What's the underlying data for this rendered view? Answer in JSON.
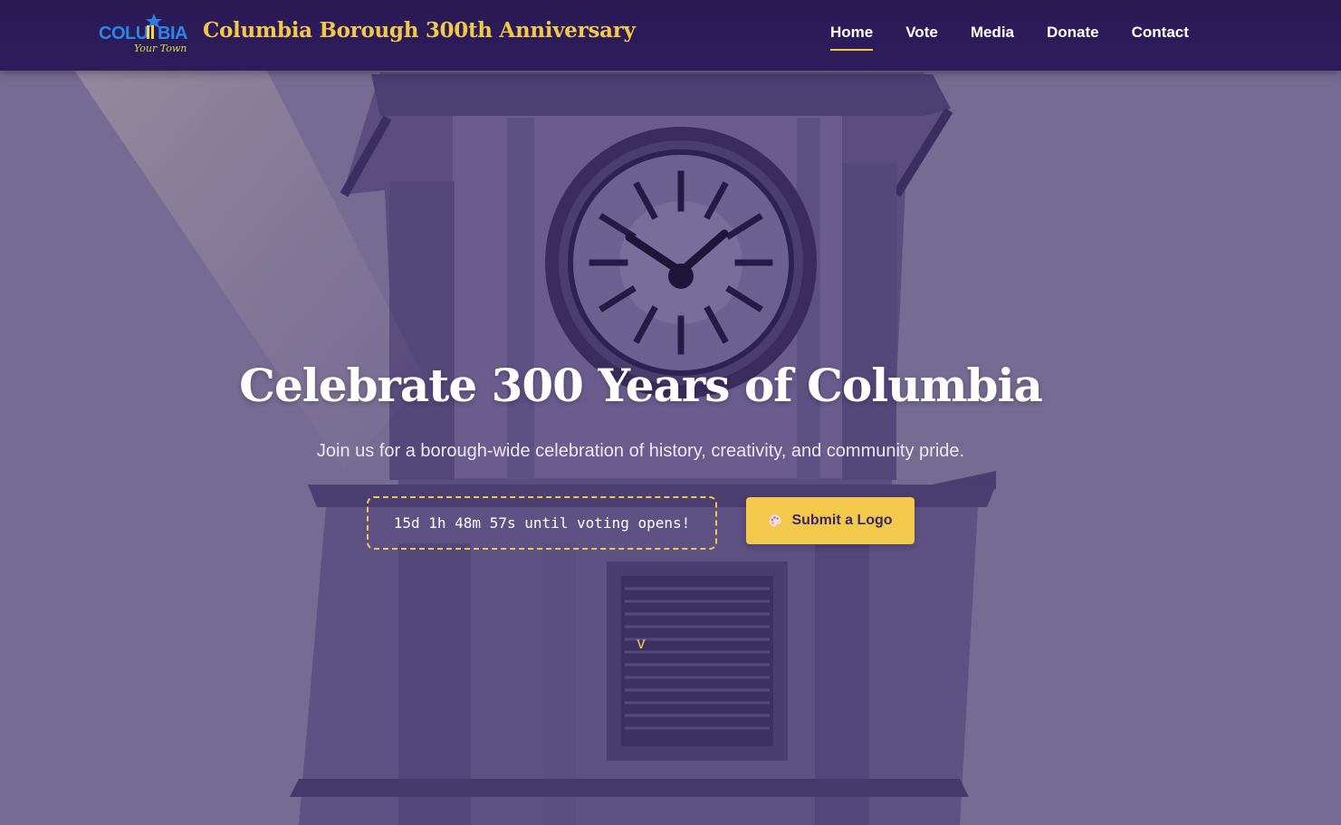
{
  "header": {
    "logo": {
      "name": "columbia-your-town-logo",
      "text_top": "COLUMBIA",
      "text_bottom": "Your Town"
    },
    "title": "Columbia Borough 300th Anniversary",
    "nav": [
      {
        "label": "Home",
        "active": true
      },
      {
        "label": "Vote",
        "active": false
      },
      {
        "label": "Media",
        "active": false
      },
      {
        "label": "Donate",
        "active": false
      },
      {
        "label": "Contact",
        "active": false
      }
    ]
  },
  "hero": {
    "title": "Celebrate 300 Years of Columbia",
    "subtitle": "Join us for a borough-wide celebration of history, creativity, and community pride.",
    "countdown_text": "15d 1h 48m 57s until voting opens!",
    "cta_label": "Submit a Logo",
    "cta_icon": "palette-icon",
    "scroll_cue": "v",
    "background": "clock-tower-photo"
  },
  "colors": {
    "nav_bg": "#2b1b58",
    "accent_gold": "#f2c84b",
    "hero_overlay": "#766b93",
    "text_white": "#ffffff"
  }
}
